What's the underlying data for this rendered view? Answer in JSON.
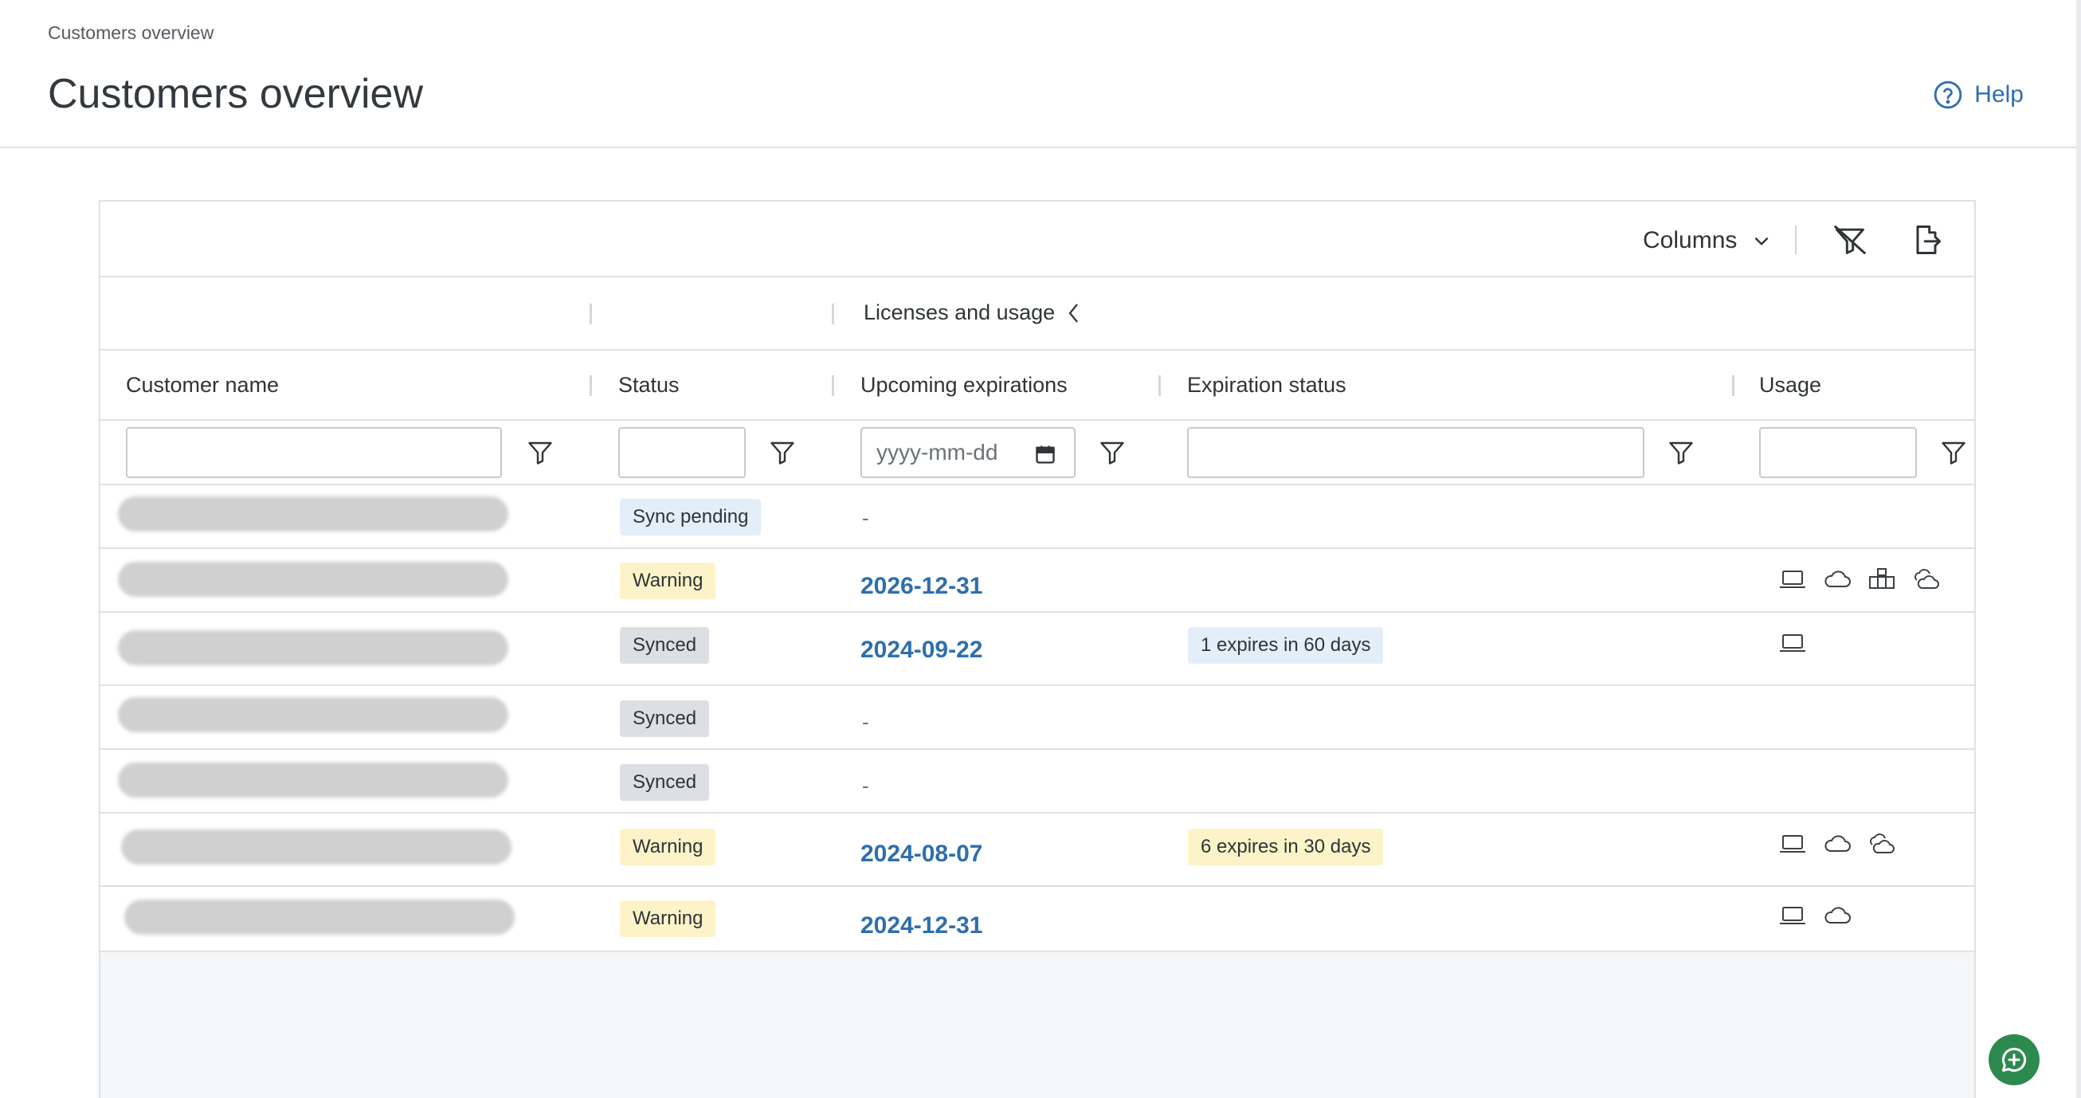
{
  "breadcrumb": "Customers overview",
  "page_title": "Customers overview",
  "help_label": "Help",
  "toolbar": {
    "columns_label": "Columns",
    "clear_filters_icon": "filter-off-icon",
    "export_icon": "export-icon"
  },
  "group_header": {
    "label": "Licenses and usage"
  },
  "columns": [
    {
      "key": "customer_name",
      "label": "Customer name"
    },
    {
      "key": "status",
      "label": "Status"
    },
    {
      "key": "upcoming_expirations",
      "label": "Upcoming expirations"
    },
    {
      "key": "expiration_status",
      "label": "Expiration status"
    },
    {
      "key": "usage",
      "label": "Usage"
    }
  ],
  "filters": {
    "customer_name": "",
    "status": "",
    "upcoming_expirations_placeholder": "yyyy-mm-dd",
    "expiration_status": "",
    "usage": ""
  },
  "rows": [
    {
      "status": "Sync pending",
      "status_kind": "pending",
      "upcoming": "-",
      "expiration_status": "",
      "usage_icons": []
    },
    {
      "status": "Warning",
      "status_kind": "warning",
      "upcoming": "2026-12-31",
      "expiration_status": "",
      "usage_icons": [
        "laptop-icon",
        "cloud-icon",
        "on-premise-icon",
        "hybrid-cloud-icon"
      ]
    },
    {
      "status": "Synced",
      "status_kind": "synced",
      "upcoming": "2024-09-22",
      "expiration_status": "1 expires in 60 days",
      "expiration_kind": "info",
      "usage_icons": [
        "laptop-icon"
      ]
    },
    {
      "status": "Synced",
      "status_kind": "synced",
      "upcoming": "-",
      "expiration_status": "",
      "usage_icons": []
    },
    {
      "status": "Synced",
      "status_kind": "synced",
      "upcoming": "-",
      "expiration_status": "",
      "usage_icons": []
    },
    {
      "status": "Warning",
      "status_kind": "warning",
      "upcoming": "2024-08-07",
      "expiration_status": "6 expires in 30 days",
      "expiration_kind": "warn",
      "usage_icons": [
        "laptop-icon",
        "cloud-icon",
        "hybrid-cloud-icon"
      ]
    },
    {
      "status": "Warning",
      "status_kind": "warning",
      "upcoming": "2024-12-31",
      "expiration_status": "",
      "usage_icons": [
        "laptop-icon",
        "cloud-icon"
      ]
    }
  ],
  "colors": {
    "accent_link": "#2e6fac",
    "warning_bg": "#fdf3c8",
    "info_bg": "#e3eef8",
    "synced_bg": "#dcdfe3",
    "chat_button": "#2c8a4f"
  }
}
